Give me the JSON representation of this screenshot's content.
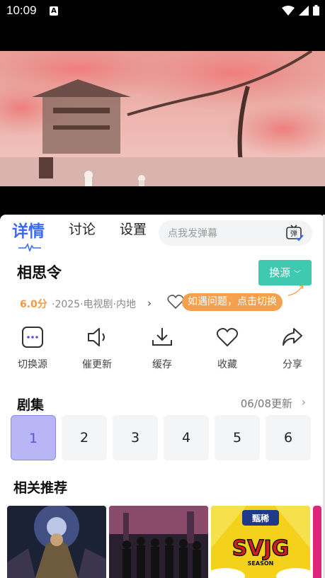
{
  "status_bar": {
    "time": "10:09",
    "a_icon": "A"
  },
  "tabs": [
    {
      "label": "详情"
    },
    {
      "label": "讨论"
    },
    {
      "label": "设置"
    }
  ],
  "danmu": {
    "placeholder": "点我发弹幕",
    "button_label": "弹"
  },
  "show": {
    "title": "相思令",
    "switch_source_label": "换源",
    "score": "6.0分",
    "meta": "·2025·电视剧·内地",
    "tip": "如遇问题，点击切换"
  },
  "actions": [
    {
      "label": "切换源",
      "icon": "source-switch-icon"
    },
    {
      "label": "催更新",
      "icon": "speaker-icon"
    },
    {
      "label": "缓存",
      "icon": "download-icon"
    },
    {
      "label": "收藏",
      "icon": "heart-icon"
    },
    {
      "label": "分享",
      "icon": "share-icon"
    }
  ],
  "episodes": {
    "title": "剧集",
    "update": "06/08更新",
    "items": [
      "1",
      "2",
      "3",
      "4",
      "5",
      "6"
    ],
    "selected": "1"
  },
  "recommend": {
    "title": "相关推荐",
    "poster3_text": "甄稀",
    "poster3_logo": "SVJG",
    "poster3_sub": "SEASON"
  },
  "colors": {
    "accent_blue": "#3b6bf5",
    "teal": "#3ec9b0",
    "orange": "#f5a04e",
    "episode_active": "#b9b6f5"
  }
}
